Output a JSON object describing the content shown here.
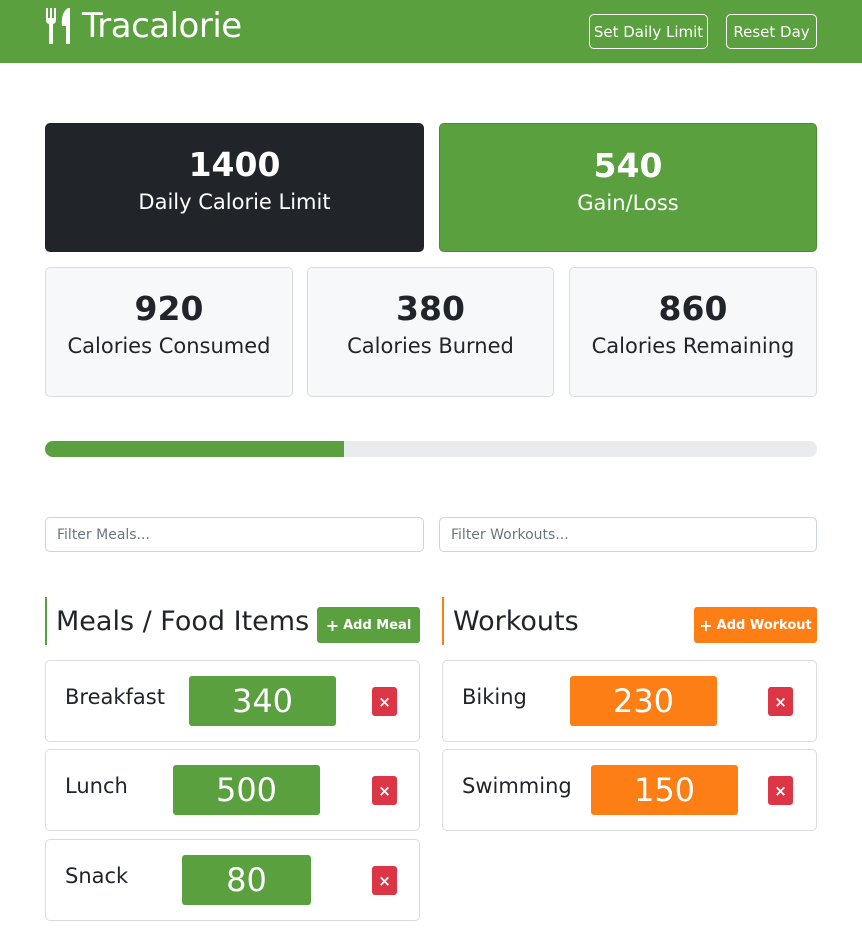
{
  "navbar": {
    "brand": "Tracalorie",
    "brand_icon": "utensils-icon",
    "set_limit_label": "Set Daily Limit",
    "reset_label": "Reset Day",
    "color": "#5aa03e"
  },
  "stats": {
    "limit": {
      "value": "1400",
      "label": "Daily Calorie Limit"
    },
    "gain_loss": {
      "value": "540",
      "label": "Gain/Loss"
    },
    "consumed": {
      "value": "920",
      "label": "Calories Consumed"
    },
    "burned": {
      "value": "380",
      "label": "Calories Burned"
    },
    "remaining": {
      "value": "860",
      "label": "Calories Remaining"
    }
  },
  "progress": {
    "fraction": 0.387
  },
  "filters": {
    "meals_placeholder": "Filter Meals...",
    "workouts_placeholder": "Filter Workouts..."
  },
  "meals": {
    "title": "Meals / Food Items",
    "add_label": "Add Meal",
    "items": [
      {
        "name": "Breakfast",
        "calories": "340"
      },
      {
        "name": "Lunch",
        "calories": "500"
      },
      {
        "name": "Snack",
        "calories": "80"
      }
    ]
  },
  "workouts": {
    "title": "Workouts",
    "add_label": "Add Workout",
    "items": [
      {
        "name": "Biking",
        "calories": "230"
      },
      {
        "name": "Swimming",
        "calories": "150"
      }
    ]
  },
  "colors": {
    "green": "#5aa03e",
    "orange": "#fd7e14",
    "dark": "#212529",
    "danger": "#dc3545"
  },
  "delete_symbol": "×",
  "plus_symbol": "+"
}
